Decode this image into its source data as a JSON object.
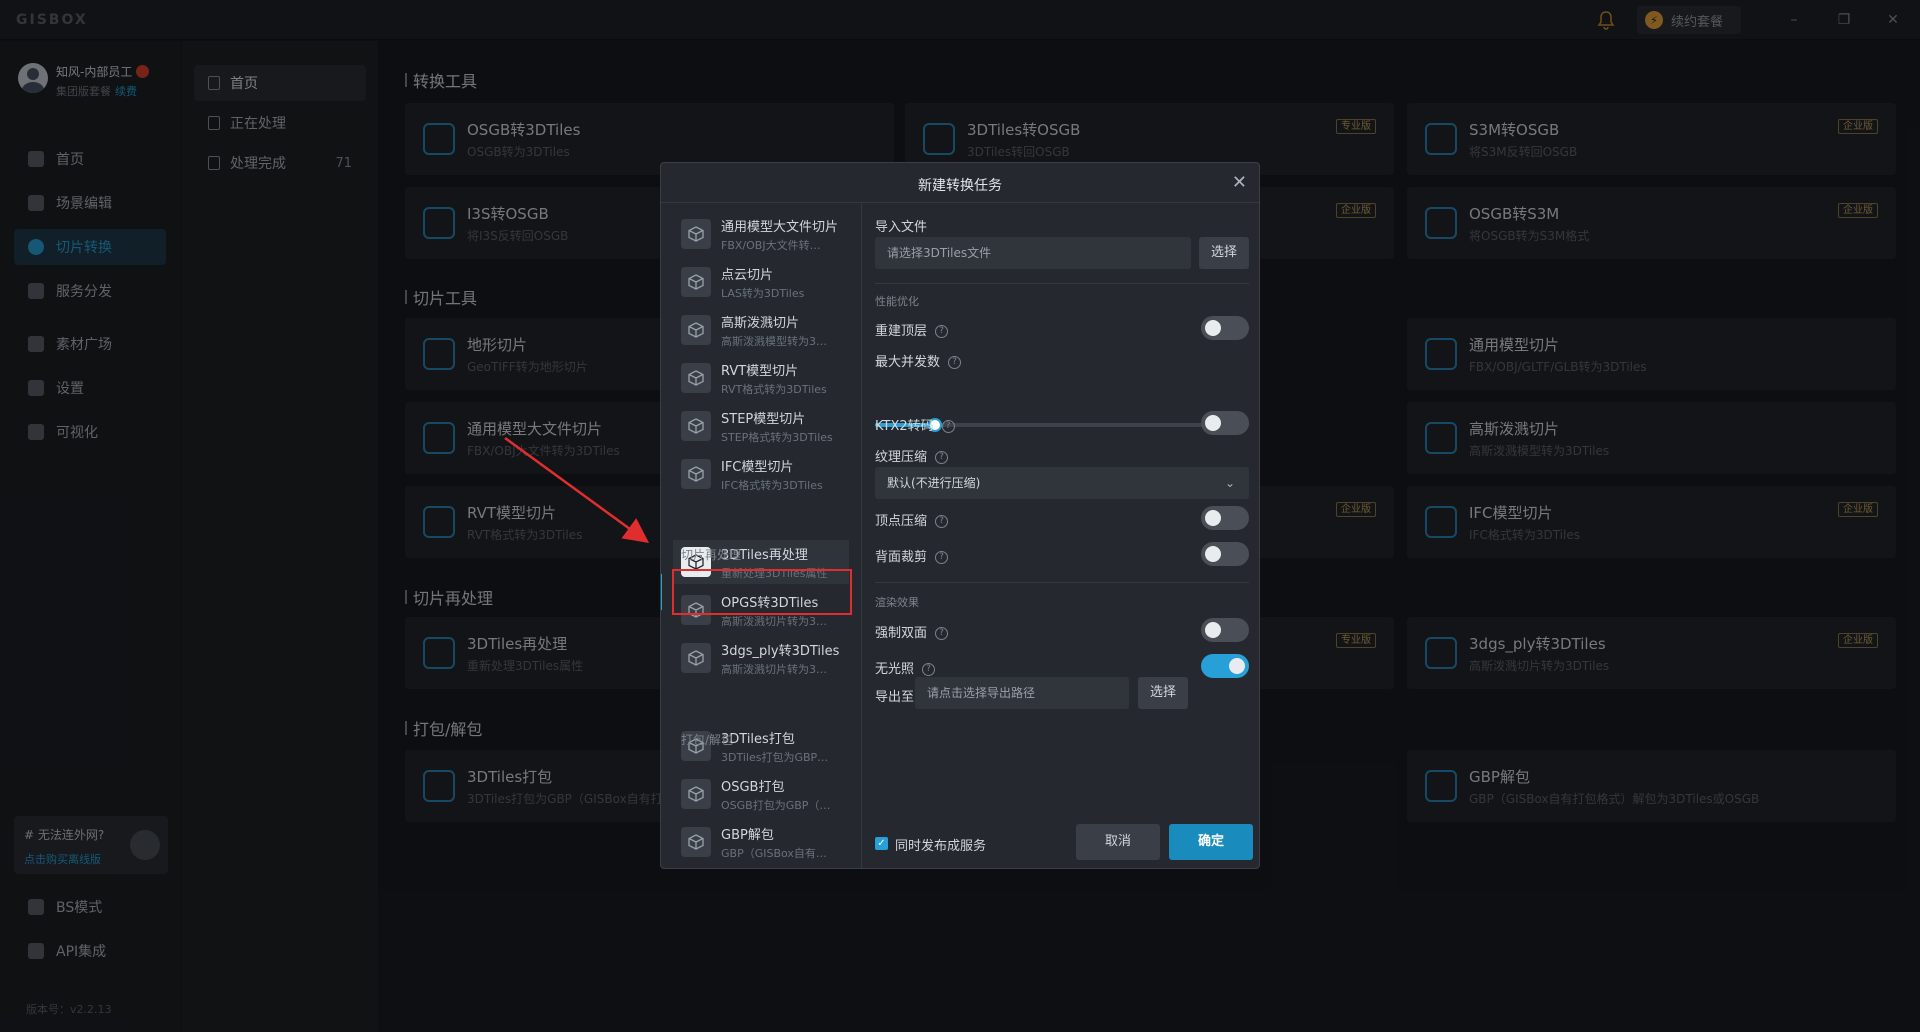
{
  "app": {
    "logo": "GISBOX",
    "renew_label": "续约套餐",
    "version": "版本号：v2.2.13"
  },
  "user": {
    "name": "知风-内部员工",
    "plan": "集团版套餐",
    "renew_link": "续费"
  },
  "sidebar": {
    "items": [
      {
        "label": "首页"
      },
      {
        "label": "场景编辑"
      },
      {
        "label": "切片转换"
      },
      {
        "label": "服务分发"
      },
      {
        "label": "素材广场"
      },
      {
        "label": "设置"
      },
      {
        "label": "可视化"
      }
    ],
    "bottom": [
      {
        "label": "BS模式"
      },
      {
        "label": "API集成"
      }
    ],
    "promo": {
      "title": "# 无法连外网?",
      "link": "点击购买离线版"
    }
  },
  "panel2": {
    "items": [
      {
        "label": "首页"
      },
      {
        "label": "正在处理"
      },
      {
        "label": "处理完成",
        "count": "71"
      }
    ]
  },
  "content": {
    "sections": [
      {
        "title": "转换工具"
      },
      {
        "title": "切片工具"
      },
      {
        "title": "切片再处理"
      },
      {
        "title": "打包/解包"
      }
    ],
    "cards": [
      {
        "title": "OSGB转3DTiles",
        "sub": "OSGB转为3DTiles"
      },
      {
        "title": "3DTiles转OSGB",
        "sub": "3DTiles转回OSGB",
        "badge": "专业版"
      },
      {
        "title": "S3M转OSGB",
        "sub": "将S3M反转回OSGB",
        "badge": "企业版"
      },
      {
        "title": "I3S转OSGB",
        "sub": "将I3S反转回OSGB"
      },
      {
        "title": "",
        "sub": "",
        "badge": "企业版"
      },
      {
        "title": "OSGB转S3M",
        "sub": "将OSGB转为S3M格式",
        "badge": "企业版"
      },
      {
        "title": "地形切片",
        "sub": "GeoTIFF转为地形切片"
      },
      {
        "title": "通用模型切片",
        "sub": "FBX/OBJ/GLTF/GLB转为3DTiles"
      },
      {
        "title": "通用模型大文件切片",
        "sub": "FBX/OBJ大文件转为3DTiles"
      },
      {
        "title": "高斯泼溅切片",
        "sub": "高斯泼溅模型转为3DTiles"
      },
      {
        "title": "RVT模型切片",
        "sub": "RVT格式转为3DTiles"
      },
      {
        "title": "",
        "sub": "",
        "badge": "企业版"
      },
      {
        "title": "IFC模型切片",
        "sub": "IFC格式转为3DTiles",
        "badge": "企业版"
      },
      {
        "title": "3DTiles再处理",
        "sub": "重新处理3DTiles属性"
      },
      {
        "title": "",
        "sub": "",
        "badge": "专业版"
      },
      {
        "title": "3dgs_ply转3DTiles",
        "sub": "高斯泼溅切片转为3DTiles",
        "badge": "企业版"
      },
      {
        "title": "3DTiles打包",
        "sub": "3DTiles打包为GBP（GISBox自有打"
      },
      {
        "title": "GBP解包",
        "sub": "GBP（GISBox自有打包格式）解包为3DTiles或OSGB"
      }
    ]
  },
  "modal": {
    "title": "新建转换任务",
    "groups": [
      "切片再处理",
      "打包/解包"
    ],
    "items": [
      {
        "title": "通用模型大文件切片",
        "sub": "FBX/OBJ大文件转…"
      },
      {
        "title": "点云切片",
        "sub": "LAS转为3DTiles"
      },
      {
        "title": "高斯泼溅切片",
        "sub": "高斯泼溅模型转为3…"
      },
      {
        "title": "RVT模型切片",
        "sub": "RVT格式转为3DTiles"
      },
      {
        "title": "STEP模型切片",
        "sub": "STEP格式转为3DTiles"
      },
      {
        "title": "IFC模型切片",
        "sub": "IFC格式转为3DTiles"
      },
      {
        "title": "3DTiles再处理",
        "sub": "重新处理3DTiles属性"
      },
      {
        "title": "OPGS转3DTiles",
        "sub": "高斯泼溅切片转为3…"
      },
      {
        "title": "3dgs_ply转3DTiles",
        "sub": "高斯泼溅切片转为3…"
      },
      {
        "title": "3DTiles打包",
        "sub": "3DTiles打包为GBP…"
      },
      {
        "title": "OSGB打包",
        "sub": "OSGB打包为GBP（…"
      },
      {
        "title": "GBP解包",
        "sub": "GBP（GISBox自有…"
      }
    ],
    "form": {
      "import_label": "导入文件",
      "import_placeholder": "请选择3DTiles文件",
      "select_label": "选择",
      "perf_label": "性能优化",
      "rebuild_top": "重建顶层",
      "rebuild_top_on": false,
      "max_concurrency": "最大并发数",
      "concurrency_fraction": 0.16,
      "ktx2": "KTX2转码",
      "ktx2_on": false,
      "texture_compress": "纹理压缩",
      "texture_value": "默认(不进行压缩)",
      "vertex_compress": "顶点压缩",
      "vertex_on": false,
      "backface": "背面裁剪",
      "backface_on": false,
      "render_label": "渲染效果",
      "double_side": "强制双面",
      "double_side_on": false,
      "unlit": "无光照",
      "unlit_on": true,
      "export_label": "导出至",
      "export_placeholder": "请点击选择导出路径",
      "publish_label": "同时发布成服务",
      "publish_checked": true,
      "cancel": "取消",
      "confirm": "确定"
    }
  },
  "colors": {
    "accent": "#27a0d8",
    "highlight": "#e02e2e",
    "bg": "#181b20"
  }
}
